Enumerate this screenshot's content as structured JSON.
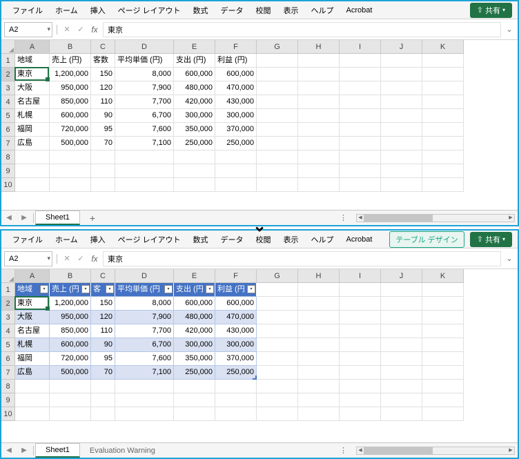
{
  "ribbon": {
    "tabs": [
      "ファイル",
      "ホーム",
      "挿入",
      "ページ レイアウト",
      "数式",
      "データ",
      "校閲",
      "表示",
      "ヘルプ",
      "Acrobat"
    ],
    "table_design": "テーブル デザイン",
    "share": "共有"
  },
  "formula": {
    "name_box": "A2",
    "value": "東京"
  },
  "columns": [
    "A",
    "B",
    "C",
    "D",
    "E",
    "F",
    "G",
    "H",
    "I",
    "J",
    "K"
  ],
  "rows": [
    "1",
    "2",
    "3",
    "4",
    "5",
    "6",
    "7",
    "8",
    "9",
    "10"
  ],
  "headers": [
    "地域",
    "売上 (円)",
    "客数",
    "平均単価 (円)",
    "支出 (円)",
    "利益 (円)"
  ],
  "headers_short": [
    "地域",
    "売上 (円",
    "客",
    "平均単価 (円",
    "支出 (円",
    "利益 (円"
  ],
  "data": [
    [
      "東京",
      "1,200,000",
      "150",
      "8,000",
      "600,000",
      "600,000"
    ],
    [
      "大阪",
      "950,000",
      "120",
      "7,900",
      "480,000",
      "470,000"
    ],
    [
      "名古屋",
      "850,000",
      "110",
      "7,700",
      "420,000",
      "430,000"
    ],
    [
      "札幌",
      "600,000",
      "90",
      "6,700",
      "300,000",
      "300,000"
    ],
    [
      "福岡",
      "720,000",
      "95",
      "7,600",
      "350,000",
      "370,000"
    ],
    [
      "広島",
      "500,000",
      "70",
      "7,100",
      "250,000",
      "250,000"
    ]
  ],
  "sheet": {
    "active": "Sheet1",
    "warning": "Evaluation Warning"
  }
}
